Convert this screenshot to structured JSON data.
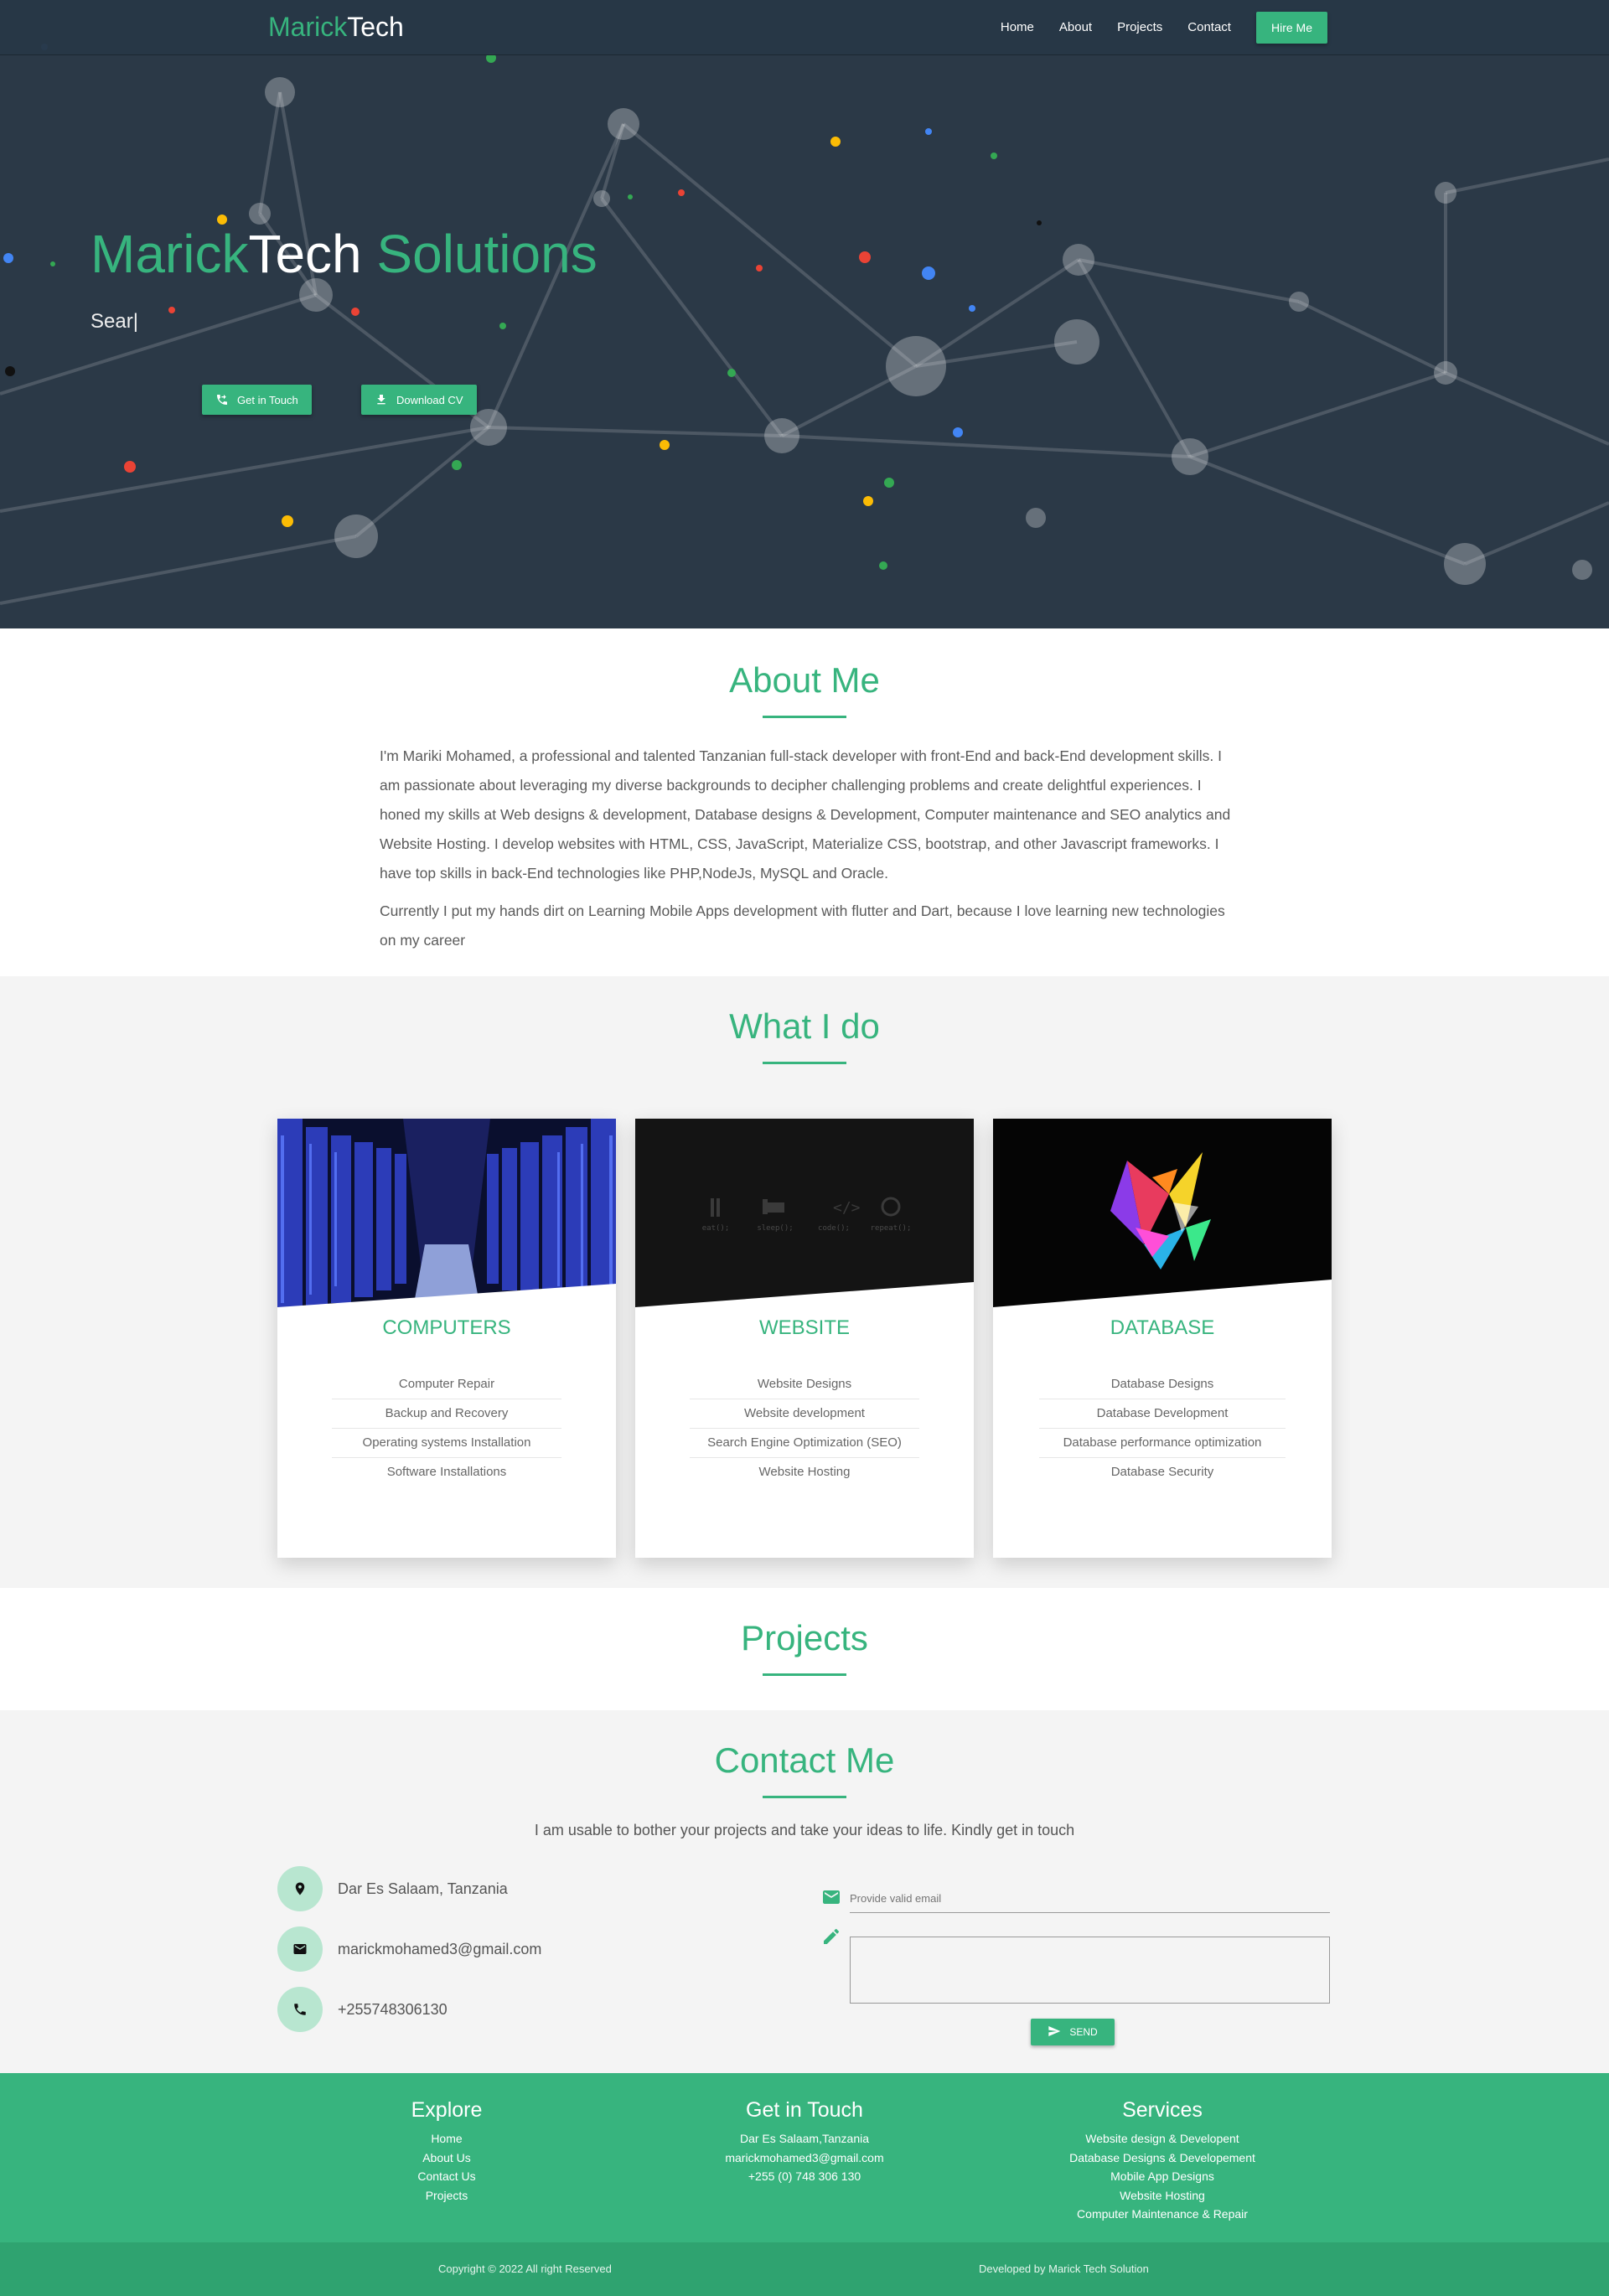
{
  "nav": {
    "brand_part1": "Marick",
    "brand_part2": "Tech",
    "links": [
      "Home",
      "About",
      "Projects",
      "Contact"
    ],
    "hire_label": "Hire Me"
  },
  "hero": {
    "title_part1": "Marick",
    "title_part2": "Tech",
    "title_part3": "Solutions",
    "typed_text": "Sear|",
    "btn_touch": "Get in Touch",
    "btn_cv": "Download CV"
  },
  "about": {
    "title": "About Me",
    "paragraph1": "I'm Mariki Mohamed, a professional and talented Tanzanian full-stack developer with front-End and back-End development skills. I am passionate about leveraging my diverse backgrounds to decipher challenging problems and create delightful experiences. I honed my skills at Web designs & development, Database designs & Development, Computer maintenance and SEO analytics and Website Hosting. I develop websites with HTML, CSS, JavaScript, Materialize CSS, bootstrap, and other Javascript frameworks. I have top skills in back-End technologies like PHP,NodeJs, MySQL and Oracle.",
    "paragraph2": "Currently I put my hands dirt on Learning Mobile Apps development with flutter and Dart, because I love learning new technologies on my career"
  },
  "whatido": {
    "title": "What I do",
    "cards": [
      {
        "title": "COMPUTERS",
        "items": [
          "Computer Repair",
          "Backup and Recovery",
          "Operating systems Installation",
          "Software Installations"
        ]
      },
      {
        "title": "WEBSITE",
        "items": [
          "Website Designs",
          "Website development",
          "Search Engine Optimization (SEO)",
          "Website Hosting"
        ],
        "image_captions": [
          "eat();",
          "sleep();",
          "code();",
          "repeat();"
        ]
      },
      {
        "title": "DATABASE",
        "items": [
          "Database Designs",
          "Database Development",
          "Database performance optimization",
          "Database Security"
        ]
      }
    ]
  },
  "projects": {
    "title": "Projects"
  },
  "contact": {
    "title": "Contact Me",
    "intro": "I am usable to bother your projects and take your ideas to life. Kindly get in touch",
    "location": "Dar Es Salaam, Tanzania",
    "email": "marickmohamed3@gmail.com",
    "phone": "+255748306130",
    "email_placeholder": "Provide valid email",
    "send_label": "SEND"
  },
  "footer": {
    "explore_title": "Explore",
    "explore_links": [
      "Home",
      "About Us",
      "Contact Us",
      "Projects"
    ],
    "touch_title": "Get in Touch",
    "touch_lines": [
      "Dar Es Salaam,Tanzania",
      "marickmohamed3@gmail.com",
      "+255 (0) 748 306 130"
    ],
    "services_title": "Services",
    "services_lines": [
      "Website design & Developent",
      "Database Designs & Developement",
      "Mobile App Designs",
      "Website Hosting",
      "Computer Maintenance & Repair"
    ],
    "copyright": "Copyright © 2022 All right Reserved",
    "developed_by": "Developed by Marick Tech Solution"
  },
  "colors": {
    "accent": "#37b47e",
    "hero_bg": "#2b3947",
    "section_alt_bg": "#f4f4f4"
  }
}
